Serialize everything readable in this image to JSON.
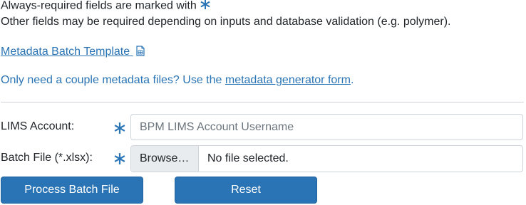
{
  "intro": {
    "required_text": "Always-required fields are marked with",
    "other_text": "Other fields may be required depending on inputs and database validation (e.g. polymer)."
  },
  "template_link": {
    "label": "Metadata Batch Template",
    "icon": "spreadsheet-file-icon"
  },
  "generator": {
    "prefix": "Only need a couple metadata files? Use the ",
    "link_label": "metadata generator form",
    "suffix": "."
  },
  "form": {
    "lims": {
      "label": "LIMS Account:",
      "placeholder": "BPM LIMS Account Username",
      "value": ""
    },
    "batch_file": {
      "label": "Batch File (*.xlsx):",
      "browse_label": "Browse…",
      "status": "No file selected."
    },
    "required_icon": "asterisk-icon"
  },
  "buttons": {
    "process": "Process Batch File",
    "reset": "Reset"
  },
  "colors": {
    "accent": "#2a74b5",
    "text": "#212529",
    "border": "#ced4da",
    "browse_bg": "#e9ecef"
  }
}
